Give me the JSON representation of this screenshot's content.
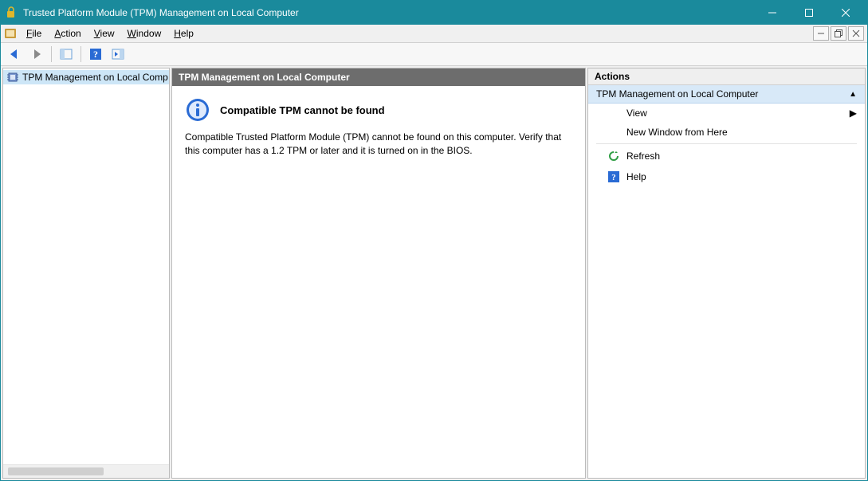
{
  "window": {
    "title": "Trusted Platform Module (TPM) Management on Local Computer"
  },
  "menu": {
    "file": "File",
    "action": "Action",
    "view": "View",
    "window": "Window",
    "help": "Help"
  },
  "tree": {
    "node_label": "TPM Management on Local Comp"
  },
  "center": {
    "header": "TPM Management on Local Computer",
    "msg_title": "Compatible TPM cannot be found",
    "msg_body": "Compatible Trusted Platform Module (TPM) cannot be found on this computer. Verify that this computer has a 1.2 TPM or later and it is turned on in the BIOS."
  },
  "actions": {
    "header": "Actions",
    "group_label": "TPM Management on Local Computer",
    "view": "View",
    "new_window": "New Window from Here",
    "refresh": "Refresh",
    "help": "Help"
  }
}
